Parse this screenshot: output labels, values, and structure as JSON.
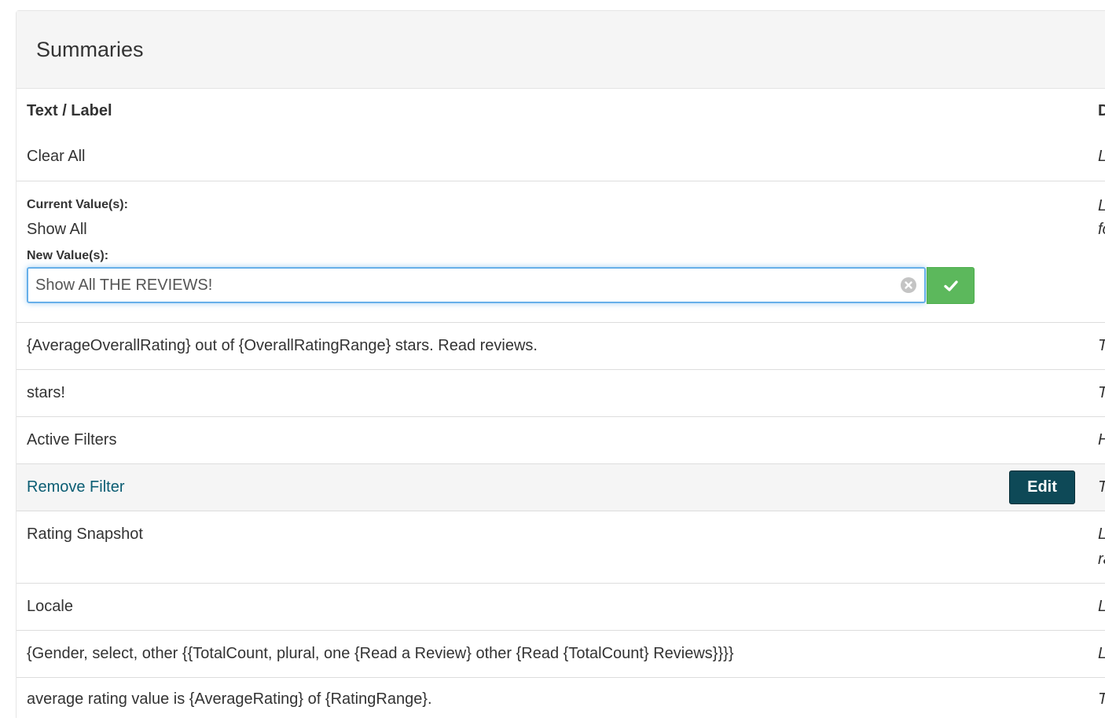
{
  "panel": {
    "title": "Summaries"
  },
  "table": {
    "header": {
      "label": "Text / Label",
      "desc_partial": "D"
    },
    "rows": [
      {
        "text": "Clear All",
        "desc": "L"
      },
      {
        "current_label": "Current Value(s):",
        "current_value": "Show All",
        "new_label": "New Value(s):",
        "new_value": "Show All THE REVIEWS!",
        "desc_line1": "L",
        "desc_line2": "fo"
      },
      {
        "text": "{AverageOverallRating} out of {OverallRatingRange} stars. Read reviews.",
        "desc": "T"
      },
      {
        "text": "stars!",
        "desc": "T"
      },
      {
        "text": "Active Filters",
        "desc": "H"
      },
      {
        "text": "Remove Filter",
        "desc": "T",
        "edit_label": "Edit"
      },
      {
        "text": "Rating Snapshot",
        "desc_line1": "L",
        "desc_line2": "ra"
      },
      {
        "text": "Locale",
        "desc": "L"
      },
      {
        "text": "{Gender, select, other {{TotalCount, plural, one {Read a Review} other {Read {TotalCount} Reviews}}}}",
        "desc": "L"
      },
      {
        "text": "average rating value is {AverageRating} of {RatingRange}.",
        "desc": "T"
      }
    ]
  },
  "colors": {
    "accent": "#66afe9",
    "success": "#5cb85c",
    "edit_button": "#0e4957",
    "link": "#0b5d73",
    "hover_row": "#f5f5f5"
  },
  "icons": {
    "clear": "circle-x-icon",
    "confirm": "checkmark-icon"
  }
}
